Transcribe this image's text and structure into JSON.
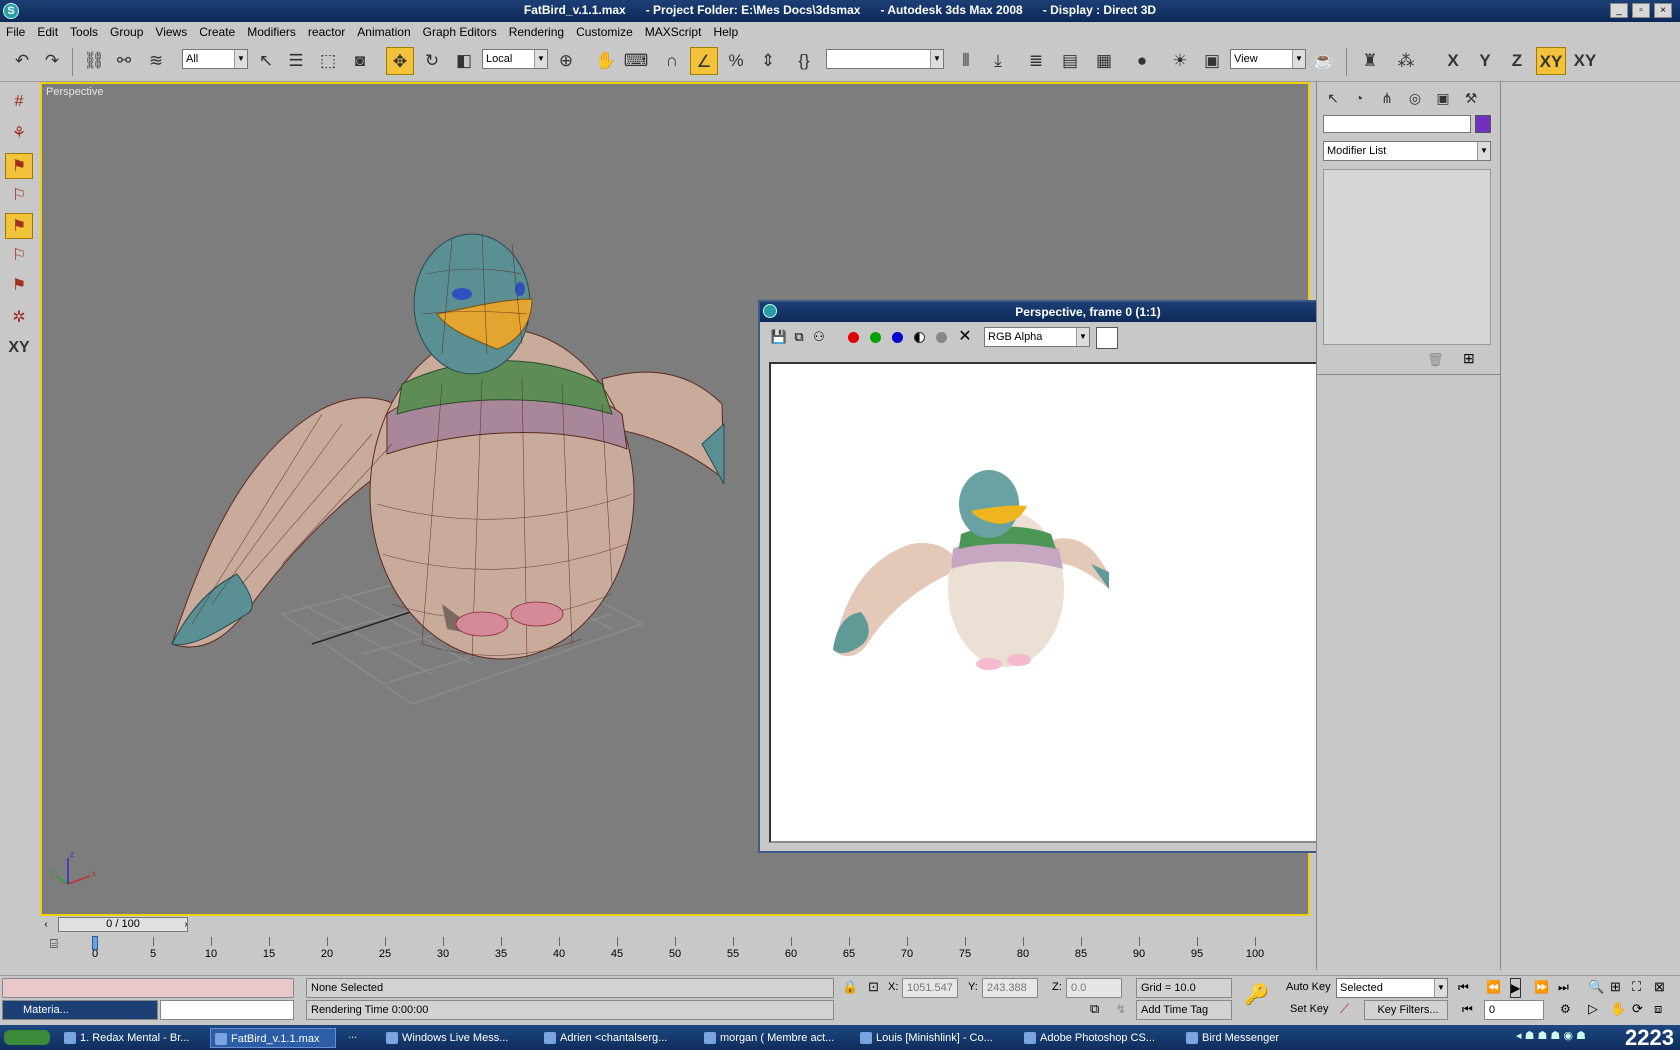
{
  "window": {
    "title": "FatBird_v.1.1.max      - Project Folder: E:\\Mes Docs\\3dsmax      - Autodesk 3ds Max 2008      - Display : Direct 3D",
    "buttons": [
      "_",
      "▫",
      "×"
    ]
  },
  "menu": [
    "File",
    "Edit",
    "Tools",
    "Group",
    "Views",
    "Create",
    "Modifiers",
    "reactor",
    "Animation",
    "Graph Editors",
    "Rendering",
    "Customize",
    "MAXScript",
    "Help"
  ],
  "toolbar": {
    "selection_filter": "All",
    "ref_coord": "Local",
    "named_selection": "",
    "view_label": "View",
    "axis_buttons": [
      "X",
      "Y",
      "Z",
      "XY",
      "XY"
    ]
  },
  "viewport": {
    "label": "Perspective",
    "axes": [
      "x",
      "y",
      "z"
    ]
  },
  "render_window": {
    "title": "Perspective, frame 0 (1:1)",
    "channel": "RGB Alpha",
    "buttons": [
      "_",
      "▫",
      "×"
    ]
  },
  "command_panel": {
    "modifier_list": "Modifier List"
  },
  "timeline": {
    "slider": "0 / 100",
    "ticks": [
      "0",
      "5",
      "10",
      "15",
      "20",
      "25",
      "30",
      "35",
      "40",
      "45",
      "50",
      "55",
      "60",
      "65",
      "70",
      "75",
      "80",
      "85",
      "90",
      "95",
      "100"
    ]
  },
  "status": {
    "selection": "None Selected",
    "prompt": "Rendering Time  0:00:00",
    "x_label": "X:",
    "x_value": "1051.547",
    "y_label": "Y:",
    "y_value": "243.388",
    "z_label": "Z:",
    "z_value": "0.0",
    "grid": "Grid = 10.0",
    "add_time_tag": "Add Time Tag",
    "auto_key": "Auto Key",
    "set_key": "Set Key",
    "key_mode": "Selected",
    "key_filters": "Key Filters...",
    "frame": "0",
    "mini_listener": "Materia..."
  },
  "taskbar": {
    "items": [
      "1. Redax Mental - Br...",
      "FatBird_v.1.1.max",
      "Windows Live Mess...",
      "Adrien <chantalserg...",
      "morgan ( Membre act...",
      "Louis [Minishlink] - Co...",
      "Adobe Photoshop CS...",
      "Bird Messenger"
    ],
    "clock": "2223",
    "more": "..."
  },
  "colors": {
    "viewport_bg": "#7d7d7d",
    "active_border": "#f0d000",
    "title_bar": "#0c2a58",
    "highlight": "#f2c23a"
  }
}
